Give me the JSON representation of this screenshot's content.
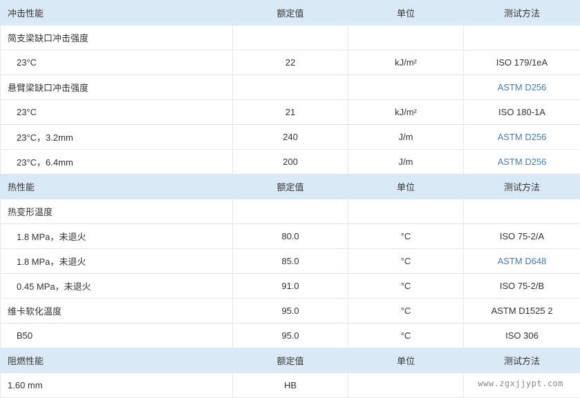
{
  "colors": {
    "header_bg": "#dbe9f7",
    "link": "#4a7ba6",
    "text": "#333333",
    "border": "#e6e6e6"
  },
  "rows": [
    {
      "kind": "header",
      "cells": [
        "冲击性能",
        "额定值",
        "单位",
        "测试方法"
      ]
    },
    {
      "kind": "group",
      "cells": [
        "简支梁缺口冲击强度",
        "",
        "",
        ""
      ]
    },
    {
      "kind": "item",
      "cells": [
        "23°C",
        "22",
        "kJ/m²",
        "ISO 179/1eA"
      ]
    },
    {
      "kind": "group",
      "cells": [
        "悬臂梁缺口冲击强度",
        "",
        "",
        "ASTM D256"
      ],
      "method_link": true
    },
    {
      "kind": "item",
      "cells": [
        "23°C",
        "21",
        "kJ/m²",
        "ISO 180-1A"
      ]
    },
    {
      "kind": "item",
      "cells": [
        "23°C，3.2mm",
        "240",
        "J/m",
        "ASTM D256"
      ],
      "method_link": true
    },
    {
      "kind": "item",
      "cells": [
        "23°C，6.4mm",
        "200",
        "J/m",
        "ASTM D256"
      ],
      "method_link": true
    },
    {
      "kind": "header",
      "cells": [
        "热性能",
        "额定值",
        "单位",
        "测试方法"
      ]
    },
    {
      "kind": "group",
      "cells": [
        "热变形温度",
        "",
        "",
        ""
      ]
    },
    {
      "kind": "item",
      "cells": [
        "1.8 MPa，未退火",
        "80.0",
        "°C",
        "ISO 75-2/A"
      ]
    },
    {
      "kind": "item",
      "cells": [
        "1.8 MPa，未退火",
        "85.0",
        "°C",
        "ASTM D648"
      ],
      "method_link": true
    },
    {
      "kind": "item",
      "cells": [
        "0.45 MPa，未退火",
        "91.0",
        "°C",
        "ISO 75-2/B"
      ]
    },
    {
      "kind": "group",
      "cells": [
        "维卡软化温度",
        "95.0",
        "°C",
        "ASTM D1525 2"
      ]
    },
    {
      "kind": "item",
      "cells": [
        "B50",
        "95.0",
        "°C",
        "ISO 306"
      ]
    },
    {
      "kind": "header",
      "cells": [
        "阻燃性能",
        "额定值",
        "单位",
        "测试方法"
      ]
    },
    {
      "kind": "group",
      "cells": [
        "1.60 mm",
        "HB",
        "",
        ""
      ]
    }
  ],
  "watermark": "www.zgxjjypt.com"
}
